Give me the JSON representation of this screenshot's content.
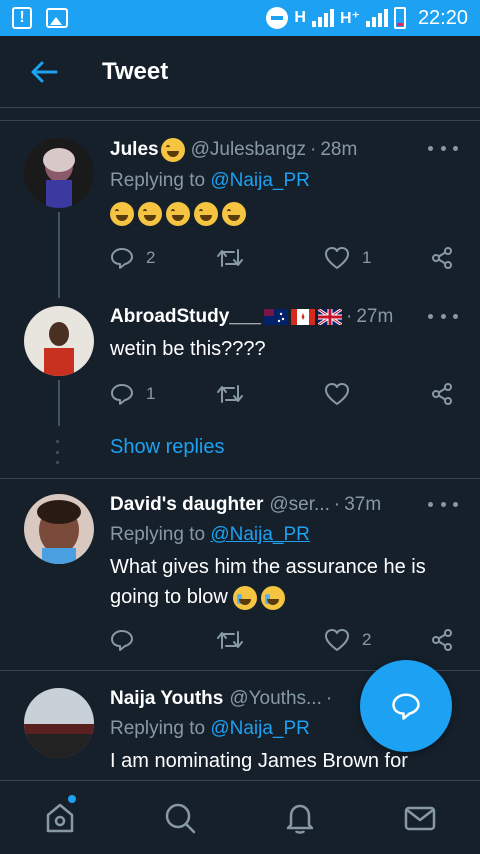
{
  "status_bar": {
    "network1": "H",
    "network2": "H⁺",
    "time": "22:20",
    "icons": [
      "alert-icon",
      "image-icon",
      "do-not-disturb-icon",
      "signal-icon",
      "battery-icon"
    ]
  },
  "header": {
    "title": "Tweet",
    "back_icon": "arrow-left-icon"
  },
  "tweets": [
    {
      "name": "Jules",
      "handle": "@Julesbangz",
      "separator": "·",
      "time": "28m",
      "replying_prefix": "Replying to",
      "replying_to": "@Naija_PR",
      "text": "",
      "emoji_count": 5,
      "reply_count": "2",
      "retweet_count": "",
      "like_count": "1"
    },
    {
      "name": "AbroadStudy___",
      "handle": "",
      "flags": [
        "australia-flag",
        "canada-flag",
        "uk-flag"
      ],
      "separator": "·",
      "time": "27m",
      "text": "wetin be this????",
      "reply_count": "1",
      "retweet_count": "",
      "like_count": ""
    },
    {
      "name": "David's daughter",
      "handle": "@ser...",
      "separator": "·",
      "time": "37m",
      "replying_prefix": "Replying to",
      "replying_to": "@Naija_PR",
      "text": "What gives him the assurance he is going to blow",
      "reply_count": "",
      "retweet_count": "",
      "like_count": "2"
    },
    {
      "name": "Naija Youths",
      "handle": "@Youths...",
      "separator": "·",
      "time": "",
      "replying_prefix": "Replying to",
      "replying_to": "@Naija_PR",
      "text": "I am nominating James Brown for"
    }
  ],
  "show_replies": "Show replies",
  "fab_icon": "compose-reply-icon",
  "bottom_nav": [
    "home-icon",
    "search-icon",
    "notifications-icon",
    "messages-icon"
  ],
  "colors": {
    "background": "#15202b",
    "accent": "#1da1f2",
    "secondary_text": "#8899a6",
    "divider": "#38444d"
  }
}
